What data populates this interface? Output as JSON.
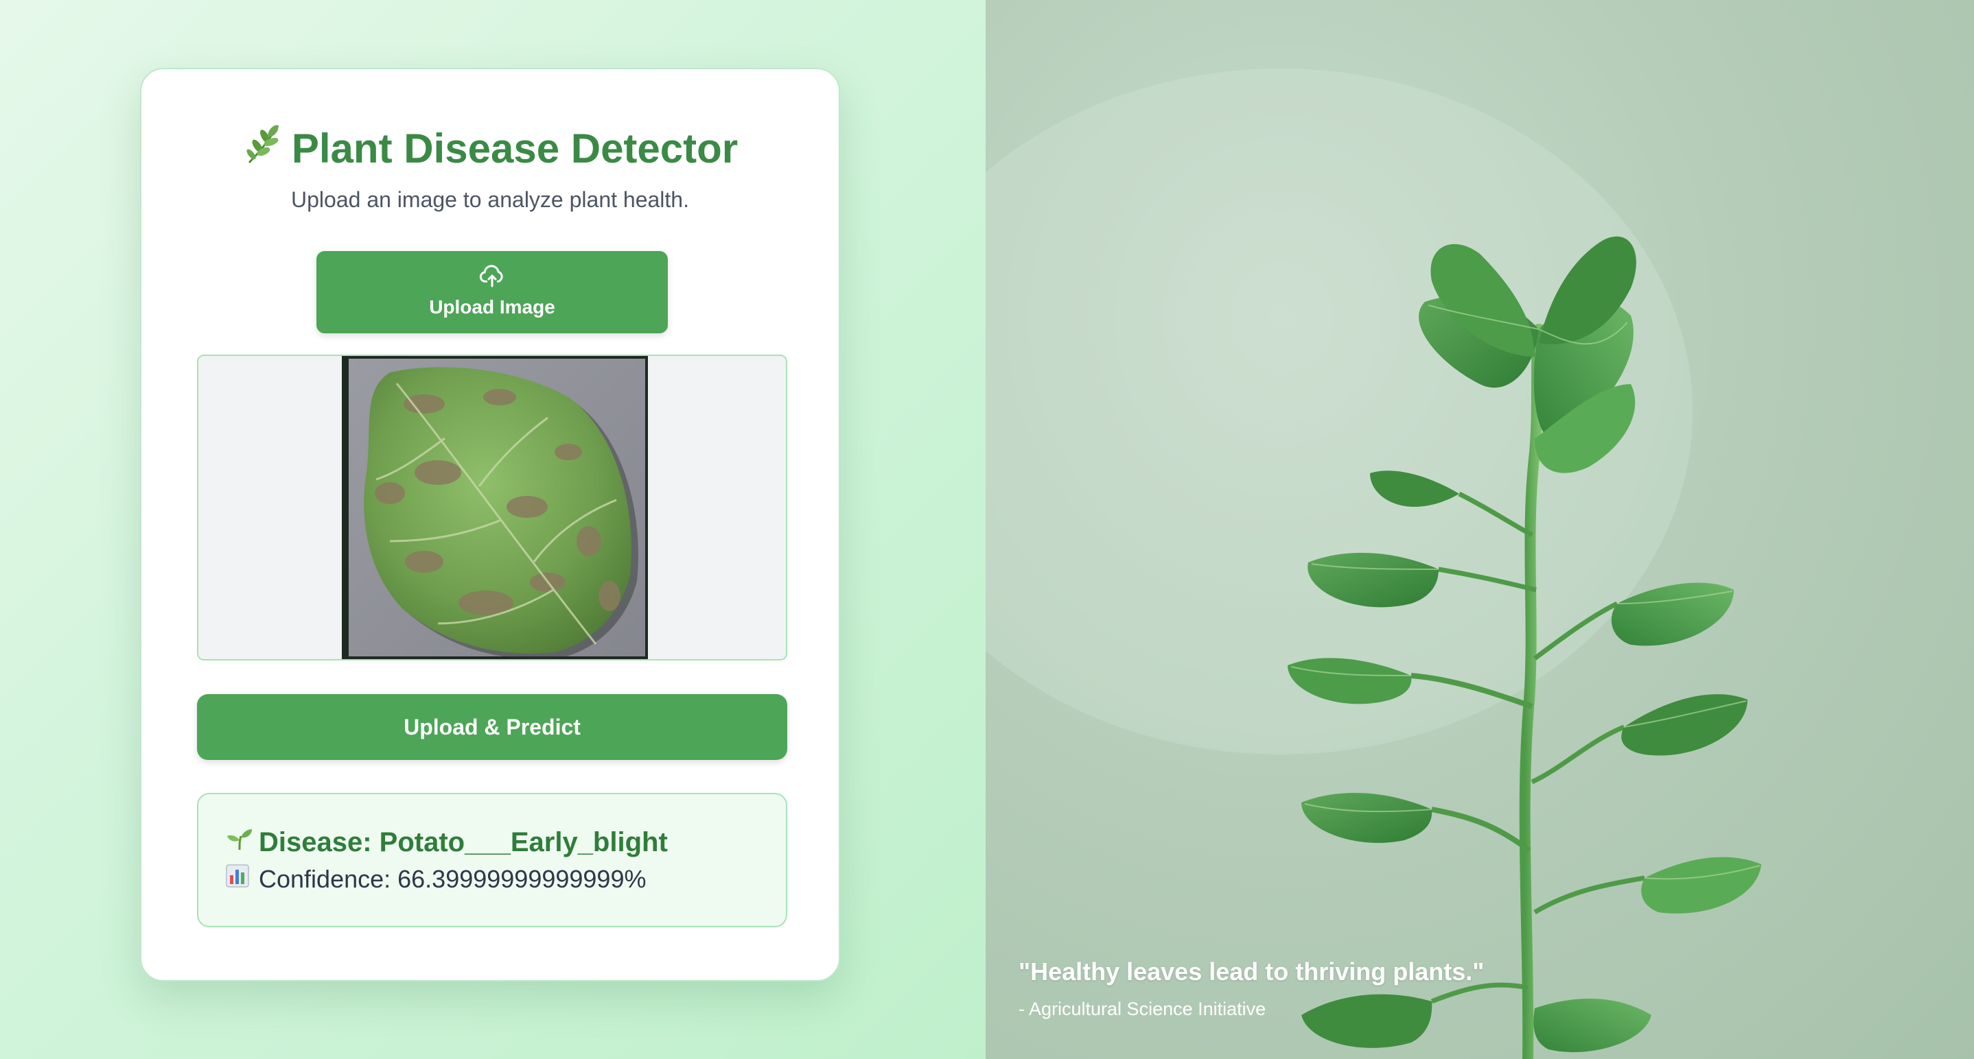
{
  "app": {
    "title": "Plant Disease Detector",
    "title_icon": "herb-icon",
    "subtitle": "Upload an image to analyze plant health."
  },
  "upload": {
    "icon": "cloud-upload-icon",
    "label": "Upload Image"
  },
  "preview": {
    "image_alt": "leaf-photo"
  },
  "predict": {
    "label": "Upload & Predict"
  },
  "result": {
    "disease_icon": "seedling-icon",
    "disease_text": "Disease: Potato___Early_blight",
    "confidence_icon": "bar-chart-icon",
    "confidence_text": "Confidence: 66.39999999999999%"
  },
  "hero": {
    "quote": "\"Healthy leaves lead to thriving plants.\"",
    "source": "- Agricultural Science Initiative"
  },
  "colors": {
    "accent": "#4da557",
    "title": "#3a8a45",
    "result_bg": "#effaf1"
  }
}
